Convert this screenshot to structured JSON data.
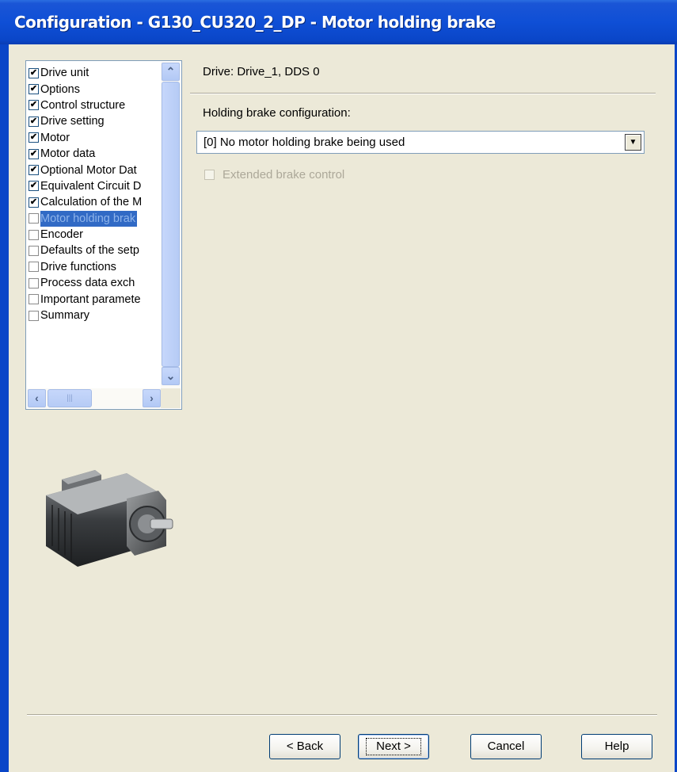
{
  "window": {
    "title": "Configuration - G130_CU320_2_DP - Motor holding brake"
  },
  "tree": {
    "items": [
      {
        "label": "Drive unit",
        "checked": true
      },
      {
        "label": "Options",
        "checked": true
      },
      {
        "label": "Control structure",
        "checked": true
      },
      {
        "label": "Drive setting",
        "checked": true
      },
      {
        "label": "Motor",
        "checked": true
      },
      {
        "label": "Motor data",
        "checked": true
      },
      {
        "label": "Optional Motor Dat",
        "checked": true
      },
      {
        "label": "Equivalent Circuit D",
        "checked": true
      },
      {
        "label": "Calculation of the M",
        "checked": true
      },
      {
        "label": "Motor holding brak",
        "checked": false,
        "selected": true
      },
      {
        "label": "Encoder",
        "checked": false
      },
      {
        "label": "Defaults of the setp",
        "checked": false
      },
      {
        "label": "Drive functions",
        "checked": false
      },
      {
        "label": "Process data exch",
        "checked": false
      },
      {
        "label": "Important paramete",
        "checked": false
      },
      {
        "label": "Summary",
        "checked": false
      }
    ]
  },
  "content": {
    "drive_info": "Drive: Drive_1, DDS 0",
    "holding_brake_label": "Holding brake configuration:",
    "holding_brake_value": "[0] No motor holding brake being used",
    "extended_brake_label": "Extended brake control"
  },
  "buttons": {
    "back": "< Back",
    "next": "Next >",
    "cancel": "Cancel",
    "help": "Help"
  },
  "icons": {
    "scroll_up": "chevron-up-icon",
    "scroll_down": "chevron-down-icon",
    "scroll_left": "chevron-left-icon",
    "scroll_right": "chevron-right-icon",
    "combo_arrow": "dropdown-arrow-icon"
  },
  "colors": {
    "titlebar": "#0a46c8",
    "selection": "#316ac5",
    "dialog_bg": "#ece9d8"
  }
}
